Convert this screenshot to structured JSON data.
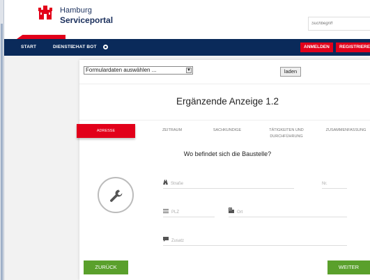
{
  "header": {
    "brand_line1": "Hamburg",
    "brand_line2": "Serviceportal",
    "search_placeholder": "Suchbegriff"
  },
  "nav": {
    "items": [
      "START",
      "DIENSTE",
      "CHAT BOT"
    ],
    "login_label": "ANMELDEN",
    "register_label": "REGISTRIEREN"
  },
  "form": {
    "select_value": "Formulardaten auswählen ...",
    "load_label": "laden",
    "title": "Ergänzende Anzeige 1.2",
    "steps": [
      {
        "label": "ADRESSE",
        "active": true
      },
      {
        "label": "ZEITRAUM",
        "active": false
      },
      {
        "label": "SACHKUNDIGE",
        "active": false
      },
      {
        "label": "TÄTIGKEITEN UND DURCHFÜHRUNG",
        "active": false
      },
      {
        "label": "ZUSAMMENFASSUNG",
        "active": false
      }
    ],
    "question": "Wo befindet sich die Baustelle?",
    "fields": {
      "street": "Straße",
      "number": "Nr.",
      "zip": "PLZ",
      "city": "Ort",
      "extra": "Zusatz"
    },
    "back_label": "ZURÜCK",
    "next_label": "WEITER"
  },
  "colors": {
    "brand_red": "#e2001a",
    "nav_blue": "#0a2a5a",
    "button_green": "#5aa02c"
  },
  "icons": [
    "hamburg-logo-icon",
    "chat-bot-icon",
    "wrench-icon",
    "road-icon",
    "grid-icon",
    "building-icon",
    "comment-icon"
  ]
}
